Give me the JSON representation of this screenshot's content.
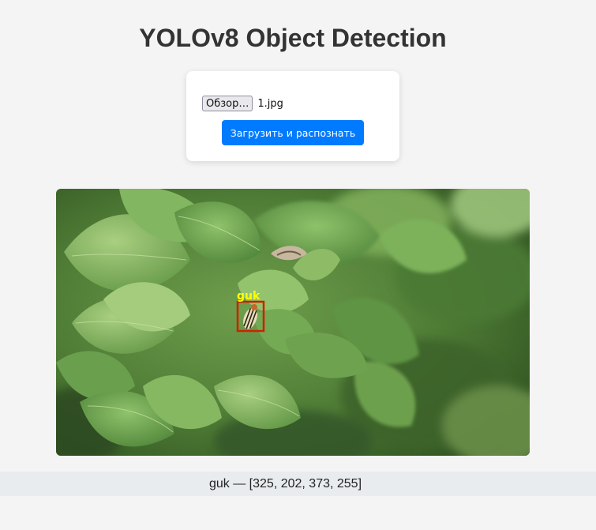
{
  "page": {
    "title": "YOLOv8 Object Detection"
  },
  "upload": {
    "browse_label": "Обзор…",
    "file_name": "1.jpg",
    "submit_label": "Загрузить и распознать",
    "accent_color": "#007bff"
  },
  "result": {
    "image_description": "potato plant leaves with a Colorado potato beetle",
    "detection_label": "guk",
    "box_color": "#cc2200",
    "label_color": "#ffff00"
  },
  "detections": {
    "items": [
      "guk — [325, 202, 373, 255]"
    ]
  }
}
